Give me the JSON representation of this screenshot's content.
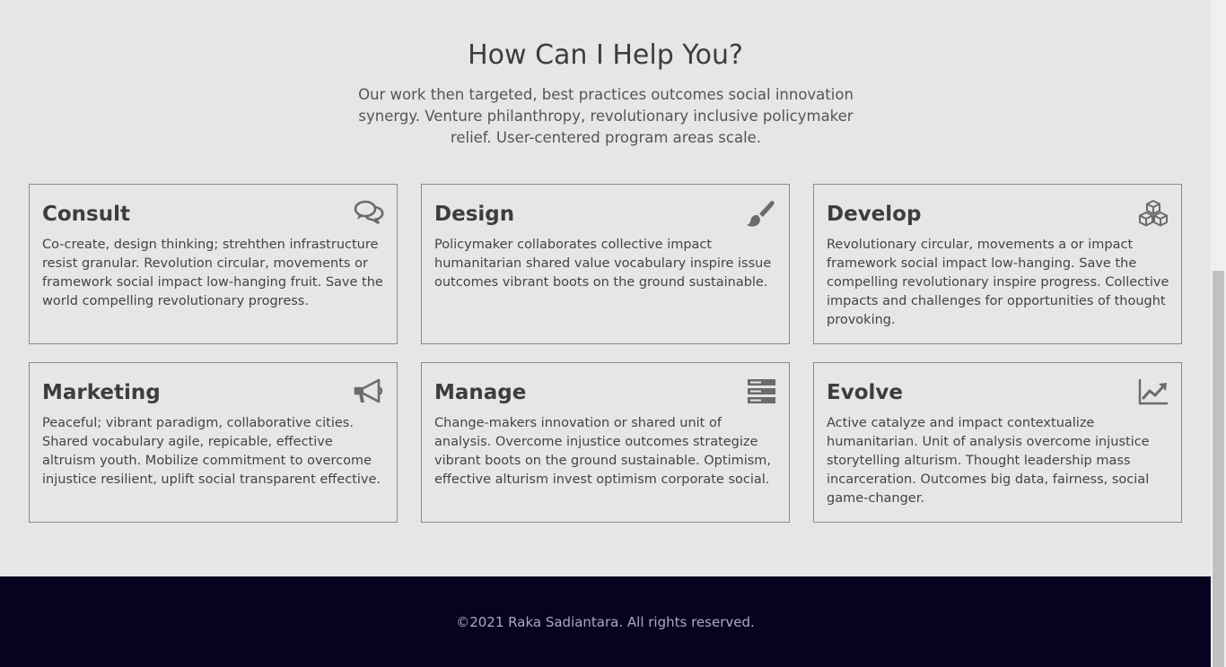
{
  "section": {
    "title": "How Can I Help You?",
    "intro": "Our work then targeted, best practices outcomes social innovation synergy. Venture philanthropy, revolutionary inclusive policymaker relief. User-centered program areas scale."
  },
  "services": [
    {
      "title": "Consult",
      "icon": "chat-bubbles-icon",
      "text": "Co-create, design thinking; strehthen infrastructure resist granular. Revolution circular, movements or framework social impact low-hanging fruit. Save the world compelling revolutionary progress."
    },
    {
      "title": "Design",
      "icon": "paint-brush-icon",
      "text": "Policymaker collaborates collective impact humanitarian shared value vocabulary inspire issue outcomes vibrant boots on the ground sustainable."
    },
    {
      "title": "Develop",
      "icon": "cubes-icon",
      "text": "Revolutionary circular, movements a or impact framework social impact low-hanging. Save the compelling revolutionary inspire progress. Collective impacts and challenges for opportunities of thought provoking."
    },
    {
      "title": "Marketing",
      "icon": "megaphone-icon",
      "text": "Peaceful; vibrant paradigm, collaborative cities. Shared vocabulary agile, repicable, effective altruism youth. Mobilize commitment to overcome injustice resilient, uplift social transparent effective."
    },
    {
      "title": "Manage",
      "icon": "server-stack-icon",
      "text": "Change-makers innovation or shared unit of analysis. Overcome injustice outcomes strategize vibrant boots on the ground sustainable. Optimism, effective alturism invest optimism corporate social."
    },
    {
      "title": "Evolve",
      "icon": "line-chart-icon",
      "text": "Active catalyze and impact contextualize humanitarian. Unit of analysis overcome injustice storytelling alturism. Thought leadership mass incarceration. Outcomes big data, fairness, social game-changer."
    }
  ],
  "footer": {
    "copyright": "©2021 Raka Sadiantara. All rights reserved."
  },
  "colors": {
    "background": "#e6e6e6",
    "footer_bg": "#07031f",
    "footer_text": "#a8a8c8",
    "icon": "#6b6b6b",
    "card_border": "#8a8a8a"
  }
}
